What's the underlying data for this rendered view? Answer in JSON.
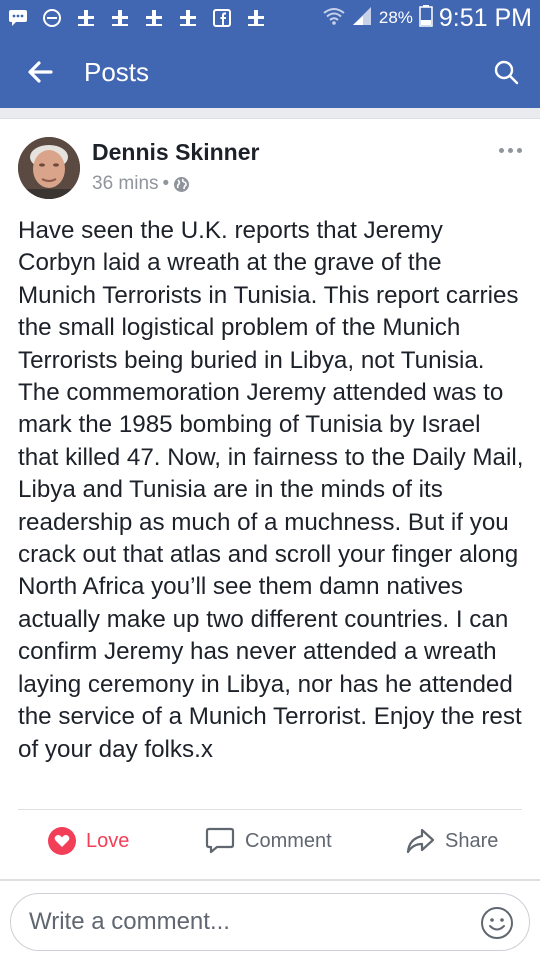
{
  "status_bar": {
    "battery": "28%",
    "time": "9:51 PM",
    "notification_icons": [
      "message-icon",
      "minus-circle-icon",
      "bridge-icon",
      "bridge-icon",
      "bridge-icon",
      "bridge-icon",
      "facebook-icon",
      "bridge-icon"
    ]
  },
  "header": {
    "title": "Posts",
    "bar_color": "#4267b2"
  },
  "post": {
    "author": "Dennis Skinner",
    "time": "36 mins",
    "separator": "•",
    "privacy_icon": "globe-icon",
    "text": "Have seen the U.K. reports that Jeremy Corbyn laid a wreath at the grave of the Munich Terrorists in Tunisia. This report carries the small logistical problem of the Munich Terrorists being buried in Libya, not Tunisia. The commemoration Jeremy attended was to mark the 1985 bombing of Tunisia by Israel that killed 47. Now, in fairness to the Daily Mail, Libya and Tunisia are in the minds of its readership as much of a muchness. But if you crack out that atlas and scroll your finger along North Africa you’ll see them damn natives actually make up two different countries. I can confirm Jeremy has never attended a wreath laying ceremony in Libya, nor has he attended the service of a Munich Terrorist. Enjoy the rest of your day folks.x"
  },
  "actions": {
    "love": "Love",
    "comment": "Comment",
    "share": "Share",
    "love_color": "#f33e58"
  },
  "comment_box": {
    "placeholder": "Write a comment..."
  }
}
